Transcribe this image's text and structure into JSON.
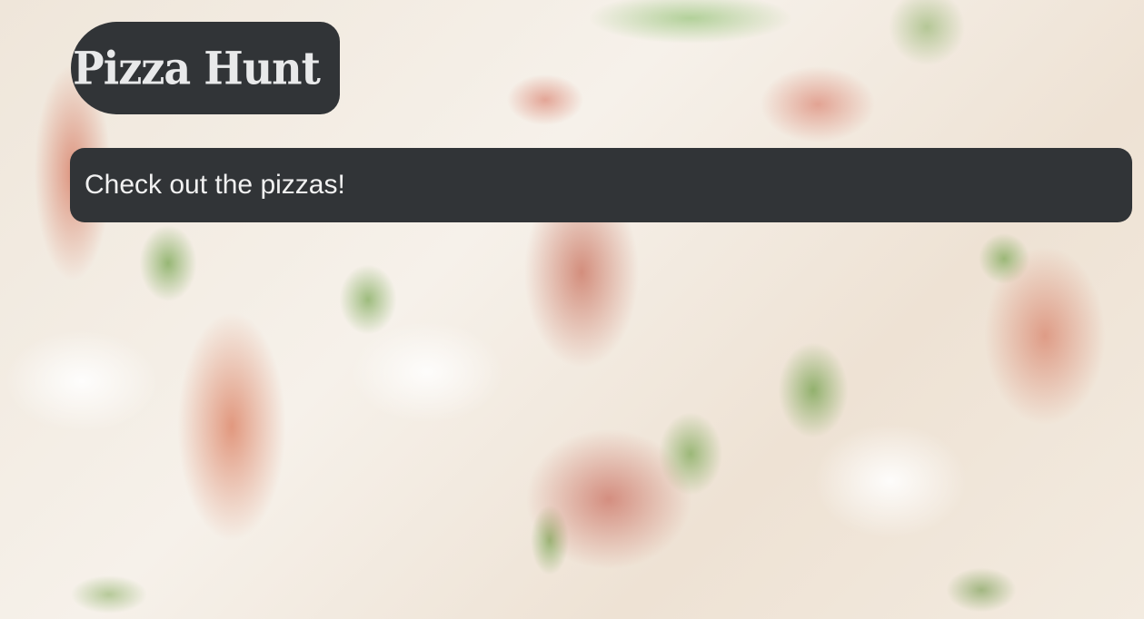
{
  "header": {
    "logo_text": "Pizza Hunt"
  },
  "main": {
    "banner_text": "Check out the pizzas!"
  },
  "colors": {
    "panel_background": "#313437",
    "panel_text": "#f1f1f1"
  }
}
